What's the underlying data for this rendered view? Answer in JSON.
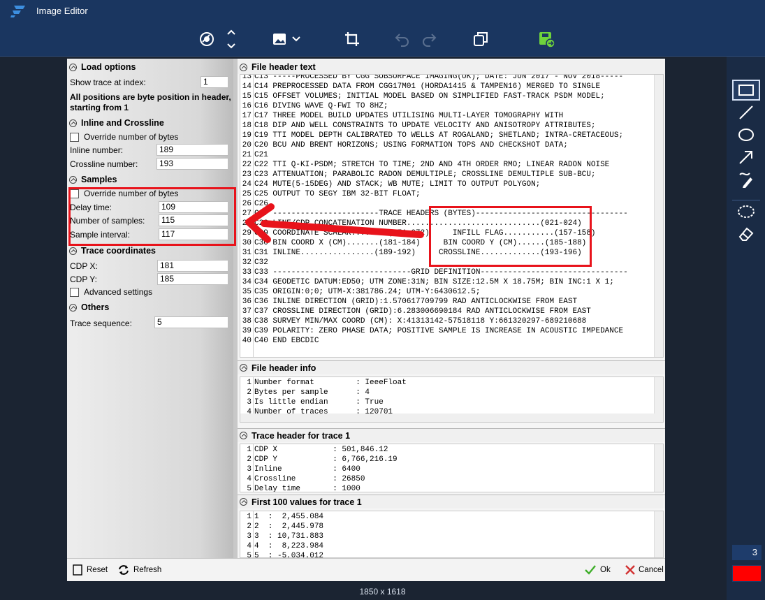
{
  "window": {
    "title": "Image Editor"
  },
  "status": {
    "dimensions": "1850 x 1618"
  },
  "tools": {
    "size_value": "3",
    "color": "#ff0000"
  },
  "dialog": {
    "load_options": {
      "header": "Load options",
      "show_trace_label": "Show trace at index:",
      "show_trace_value": "1",
      "note": "All positions are byte position in header, starting from 1"
    },
    "inline_crossline": {
      "header": "Inline and Crossline",
      "override_label": "Override number of bytes",
      "inline_label": "Inline number:",
      "inline_value": "189",
      "crossline_label": "Crossline number:",
      "crossline_value": "193"
    },
    "samples": {
      "header": "Samples",
      "override_label": "Override number of bytes",
      "delay_label": "Delay time:",
      "delay_value": "109",
      "num_label": "Number of samples:",
      "num_value": "115",
      "interval_label": "Sample interval:",
      "interval_value": "117"
    },
    "trace_coords": {
      "header": "Trace coordinates",
      "cdpx_label": "CDP X:",
      "cdpx_value": "181",
      "cdpy_label": "CDP Y:",
      "cdpy_value": "185",
      "advanced_label": "Advanced settings"
    },
    "others": {
      "header": "Others",
      "trace_seq_label": "Trace sequence:",
      "trace_seq_value": "5"
    },
    "file_header_text": {
      "header": "File header text",
      "lines": [
        "13 C13 -----PROCESSED BY CGG SUBSURFACE IMAGING(UK); DATE: JUN 2017 - NOV 2018-----",
        "14 C14 PREPROCESSED DATA FROM CGG17M01 (HORDA1415 & TAMPEN16) MERGED TO SINGLE",
        "15 C15 OFFSET VOLUMES; INITIAL MODEL BASED ON SIMPLIFIED FAST-TRACK PSDM MODEL;",
        "16 C16 DIVING WAVE Q-FWI TO 8HZ;",
        "17 C17 THREE MODEL BUILD UPDATES UTILISING MULTI-LAYER TOMOGRAPHY WITH",
        "18 C18 DIP AND WELL CONSTRAINTS TO UPDATE VELOCITY AND ANISOTROPY ATTRIBUTES;",
        "19 C19 TTI MODEL DEPTH CALIBRATED TO WELLS AT ROGALAND; SHETLAND; INTRA-CRETACEOUS;",
        "20 C20 BCU AND BRENT HORIZONS; USING FORMATION TOPS AND CHECKSHOT DATA;",
        "21 C21",
        "22 C22 TTI Q-KI-PSDM; STRETCH TO TIME; 2ND AND 4TH ORDER RMO; LINEAR RADON NOISE",
        "23 C23 ATTENUATION; PARABOLIC RADON DEMULTIPLE; CROSSLINE DEMULTIPLE SUB-BCU;",
        "24 C24 MUTE(5-15DEG) AND STACK; WB MUTE; LIMIT TO OUTPUT POLYGON;",
        "25 C25 OUTPUT TO SEGY IBM 32-BIT FLOAT;",
        "26 C26",
        "27 C27 -----------------------TRACE HEADERS (BYTES)---------------------------------",
        "28 C28 LINE/CDP CONCATENATION NUMBER.............................(021-024)",
        "29 C29 COORDINATE SCALAR........(071-072)     INFILL FLAG...........(157-158)",
        "30 C30 BIN COORD X (CM).......(181-184)     BIN COORD Y (CM)......(185-188)",
        "31 C31 INLINE................(189-192)     CROSSLINE.............(193-196)",
        "32 C32",
        "33 C33 ------------------------------GRID DEFINITION--------------------------------",
        "34 C34 GEODETIC DATUM:ED50; UTM ZONE:31N; BIN SIZE:12.5M X 18.75M; BIN INC:1 X 1;",
        "35 C35 ORIGIN:0;0; UTM-X:381786.24; UTM-Y:6430612.5;",
        "36 C36 INLINE DIRECTION (GRID):1.570617709799 RAD ANTICLOCKWISE FROM EAST",
        "37 C37 CROSSLINE DIRECTION (GRID):6.283006690184 RAD ANTICLOCKWISE FROM EAST",
        "38 C38 SURVEY MIN/MAX COORD (CM): X:41313142-57518118 Y:661320297-689210688",
        "39 C39 POLARITY: ZERO PHASE DATA; POSITIVE SAMPLE IS INCREASE IN ACOUSTIC IMPEDANCE",
        "40 C40 END EBCDIC"
      ]
    },
    "file_header_info": {
      "header": "File header info",
      "lines": [
        "1 Number format         : IeeeFloat",
        "2 Bytes per sample      : 4",
        "3 Is little endian      : True",
        "4 Number of traces      : 120701"
      ]
    },
    "trace_header": {
      "header": "Trace header for trace 1",
      "lines": [
        "1 CDP X            : 501,846.12",
        "2 CDP Y            : 6,766,216.19",
        "3 Inline           : 6400",
        "4 Crossline        : 26850",
        "5 Delay time       : 1000"
      ]
    },
    "first_values": {
      "header": "First 100 values for trace 1",
      "lines": [
        "1 1  :  2,455.084",
        "2 2  :  2,445.978",
        "3 3  : 10,731.883",
        "4 4  :  8,223.984",
        "5 5  : -5,034.012"
      ]
    },
    "buttons": {
      "reset": "Reset",
      "refresh": "Refresh",
      "ok": "Ok",
      "cancel": "Cancel"
    }
  }
}
